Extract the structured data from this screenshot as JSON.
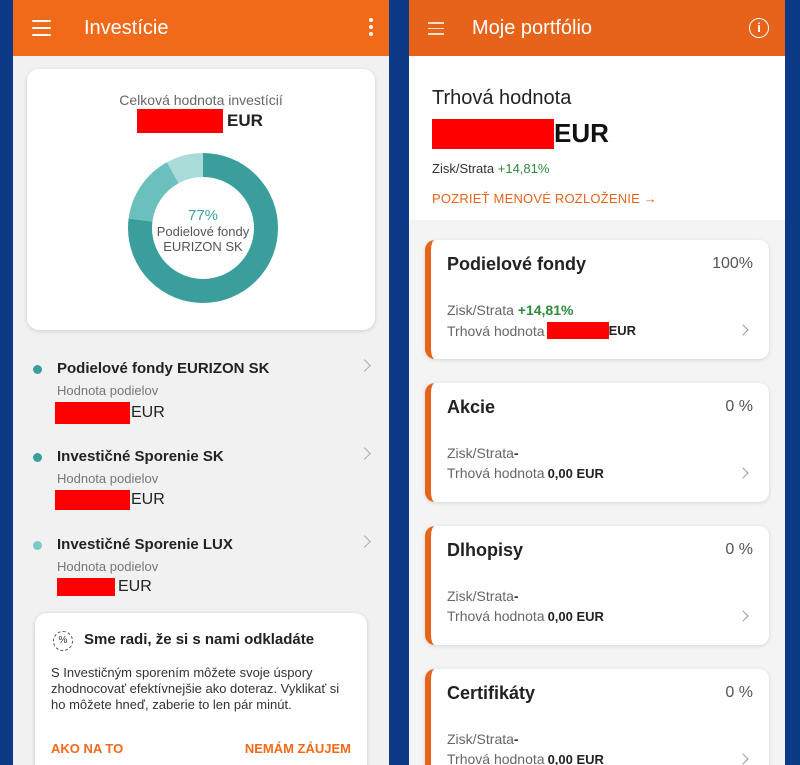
{
  "left": {
    "app_title": "Investície",
    "summary": {
      "label": "Celková hodnota investícií",
      "currency": "EUR",
      "donut_percent": "77%",
      "donut_line1": "Podielové fondy",
      "donut_line2": "EURIZON SK",
      "segments": [
        {
          "share": 0.77,
          "color": "#3a9f9c"
        },
        {
          "share": 0.15,
          "color": "#6bbfbc"
        },
        {
          "share": 0.08,
          "color": "#a9dcd9"
        }
      ]
    },
    "funds": [
      {
        "name": "Podielové fondy EURIZON SK",
        "sub_label": "Hodnota podielov",
        "currency": "EUR",
        "dot_color": "#3a9f9c"
      },
      {
        "name": "Investičné Sporenie SK",
        "sub_label": "Hodnota podielov",
        "currency": "EUR",
        "dot_color": "#3a9f9c"
      },
      {
        "name": "Investičné Sporenie LUX",
        "sub_label": "Hodnota podielov",
        "currency": "EUR",
        "dot_color": "#7ccac7"
      }
    ],
    "promo": {
      "title": "Sme radi, že si s nami odkladáte",
      "text": "S Investičným sporením môžete svoje úspory zhodnocovať efektívnejšie ako doteraz. Vyklikať si ho môžete hneď, zaberie to len pár minút.",
      "primary_button": "AKO NA TO",
      "secondary_button": "NEMÁM ZÁUJEM"
    }
  },
  "right": {
    "app_title": "Moje portfólio",
    "market_value_label": "Trhová hodnota",
    "currency": "EUR",
    "gain_label": "Zisk/Strata",
    "gain_value": "+14,81%",
    "currency_link": "POZRIEŤ MENOVÉ ROZLOŽENIE →",
    "assets": [
      {
        "name": "Podielové fondy",
        "percent": "100%",
        "gain_label": "Zisk/Strata",
        "gain_value": "+14,81%",
        "value_label": "Trhová hodnota",
        "value": "",
        "currency": "EUR"
      },
      {
        "name": "Akcie",
        "percent": "0 %",
        "gain_label": "Zisk/Strata",
        "gain_value": "-",
        "value_label": "Trhová hodnota",
        "value": "0,00 EUR",
        "currency": ""
      },
      {
        "name": "Dlhopisy",
        "percent": "0 %",
        "gain_label": "Zisk/Strata",
        "gain_value": "-",
        "value_label": "Trhová hodnota",
        "value": "0,00 EUR",
        "currency": ""
      },
      {
        "name": "Certifikáty",
        "percent": "0 %",
        "gain_label": "Zisk/Strata",
        "gain_value": "-",
        "value_label": "Trhová hodnota",
        "value": "0,00 EUR",
        "currency": ""
      }
    ]
  },
  "colors": {
    "accent_orange": "#f06a1a",
    "teal": "#3a9f9c",
    "gain_green": "#2e8b3a",
    "redaction": "#ff0000"
  }
}
